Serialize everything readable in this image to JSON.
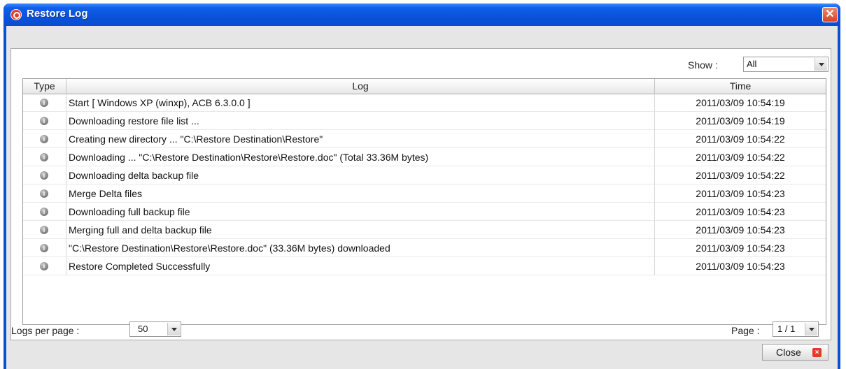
{
  "window": {
    "title": "Restore Log",
    "close_glyph": "✕"
  },
  "filter": {
    "show_label": "Show :",
    "show_value": "All"
  },
  "table": {
    "columns": [
      "Type",
      "Log",
      "Time"
    ],
    "type_icon": "info-icon",
    "rows": [
      {
        "log": "Start [ Windows XP (winxp), ACB 6.3.0.0 ]",
        "time": "2011/03/09 10:54:19"
      },
      {
        "log": "Downloading restore file list ...",
        "time": "2011/03/09 10:54:19"
      },
      {
        "log": "Creating new directory ... \"C:\\Restore Destination\\Restore\"",
        "time": "2011/03/09 10:54:22"
      },
      {
        "log": "Downloading ... \"C:\\Restore Destination\\Restore\\Restore.doc\" (Total 33.36M bytes)",
        "time": "2011/03/09 10:54:22"
      },
      {
        "log": "Downloading delta backup file",
        "time": "2011/03/09 10:54:22"
      },
      {
        "log": "Merge Delta files",
        "time": "2011/03/09 10:54:23"
      },
      {
        "log": "Downloading full backup file",
        "time": "2011/03/09 10:54:23"
      },
      {
        "log": "Merging full and delta backup file",
        "time": "2011/03/09 10:54:23"
      },
      {
        "log": "\"C:\\Restore Destination\\Restore\\Restore.doc\" (33.36M bytes) downloaded",
        "time": "2011/03/09 10:54:23"
      },
      {
        "log": "Restore Completed Successfully",
        "time": "2011/03/09 10:54:23"
      }
    ]
  },
  "footer": {
    "logs_per_page_label": "Logs per page :",
    "logs_per_page_value": "50",
    "page_label": "Page :",
    "page_value": "1 / 1",
    "close_label": "Close"
  },
  "colors": {
    "titlebar": "#0a52da",
    "close_accent": "#e23b2a"
  }
}
